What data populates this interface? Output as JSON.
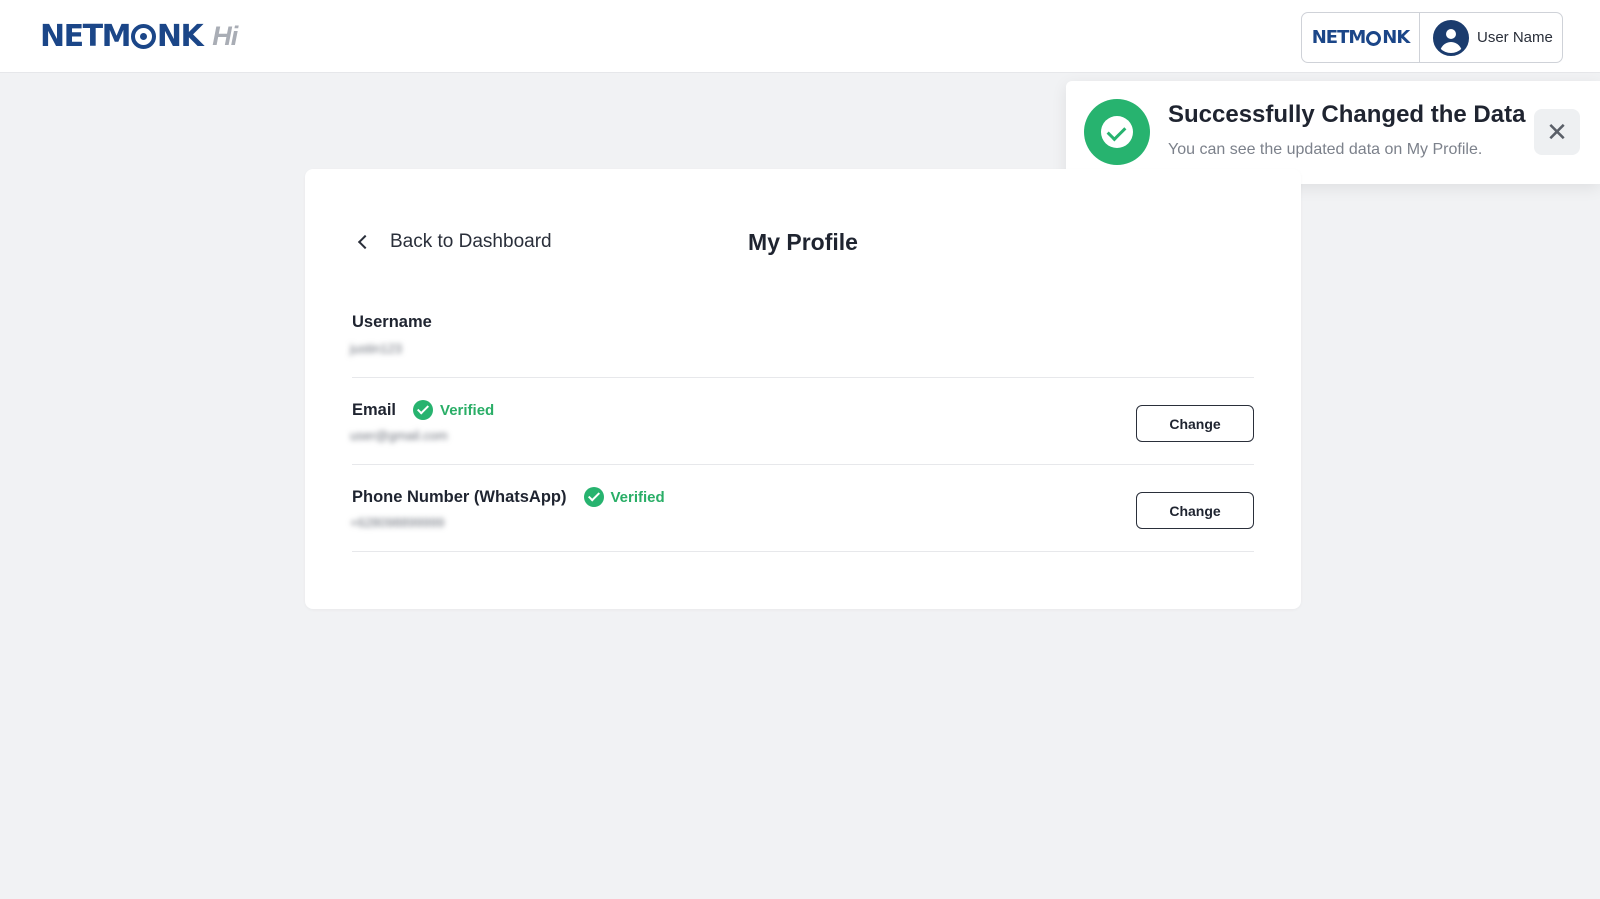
{
  "header": {
    "brand_name": "NETMONK",
    "brand_suffix": "Hi",
    "partner_brand": "NETMONK",
    "user_name": "User Name"
  },
  "toast": {
    "title": "Successfully Changed the Data",
    "message": "You can see the updated data on My Profile.",
    "close_icon": "close-icon",
    "status_color": "#27b36f"
  },
  "profile": {
    "back_label": "Back to Dashboard",
    "title": "My Profile",
    "fields": [
      {
        "label": "Username",
        "value": "justin123",
        "verified": false
      },
      {
        "label": "Email",
        "value": "user@gmail.com",
        "verified": true,
        "verified_label": "Verified",
        "action_label": "Change"
      },
      {
        "label": "Phone Number (WhatsApp)",
        "value": "+628098899999",
        "verified": true,
        "verified_label": "Verified",
        "action_label": "Change"
      }
    ]
  },
  "colors": {
    "brand": "#1b4688",
    "success": "#27b36f",
    "background": "#f1f2f4"
  }
}
